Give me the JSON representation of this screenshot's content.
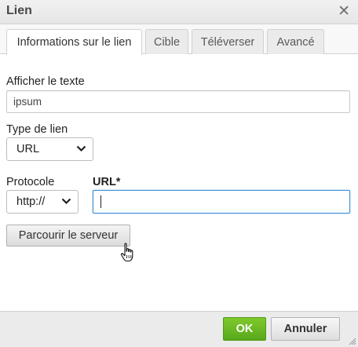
{
  "dialog": {
    "title": "Lien"
  },
  "tabs": [
    {
      "label": "Informations sur le lien"
    },
    {
      "label": "Cible"
    },
    {
      "label": "Téléverser"
    },
    {
      "label": "Avancé"
    }
  ],
  "form": {
    "display_text": {
      "label": "Afficher le texte",
      "value": "ipsum"
    },
    "link_type": {
      "label": "Type de lien",
      "value": "URL"
    },
    "protocol": {
      "label": "Protocole",
      "value": "http://"
    },
    "url": {
      "label": "URL*",
      "value": ""
    },
    "browse_label": "Parcourir le serveur"
  },
  "footer": {
    "ok_label": "OK",
    "cancel_label": "Annuler"
  },
  "colors": {
    "ok": "#67b621",
    "focus": "#3d8fd8",
    "title_bar": "#ebebeb"
  },
  "icons": {
    "close": "close-icon",
    "chevron": "chevron-down-icon",
    "pointer": "hand-pointer-icon"
  }
}
